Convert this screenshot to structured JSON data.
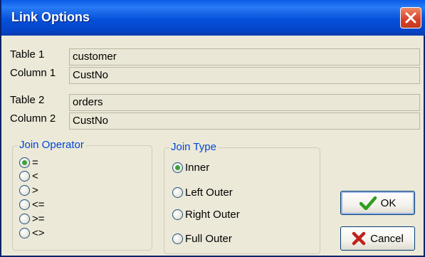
{
  "window": {
    "title": "Link Options"
  },
  "fields": [
    {
      "label": "Table 1",
      "value": "customer"
    },
    {
      "label": "Column 1",
      "value": "CustNo"
    },
    {
      "label": "Table 2",
      "value": "orders"
    },
    {
      "label": "Column 2",
      "value": "CustNo"
    }
  ],
  "join_operator": {
    "title": "Join Operator",
    "options": [
      "=",
      "<",
      ">",
      "<=",
      ">=",
      "<>"
    ],
    "selected": "="
  },
  "join_type": {
    "title": "Join Type",
    "options": [
      "Inner",
      "Left Outer",
      "Right Outer",
      "Full Outer"
    ],
    "selected": "Inner"
  },
  "buttons": {
    "ok": "OK",
    "cancel": "Cancel"
  },
  "icons": {
    "close": "close-icon",
    "ok": "checkmark-icon",
    "cancel": "x-icon"
  },
  "colors": {
    "title_bar": "#0A5BE8",
    "group_title": "#0046D5",
    "ok_check": "#2E9E1E",
    "cancel_x": "#C0201A",
    "close_button": "#D5402A"
  }
}
